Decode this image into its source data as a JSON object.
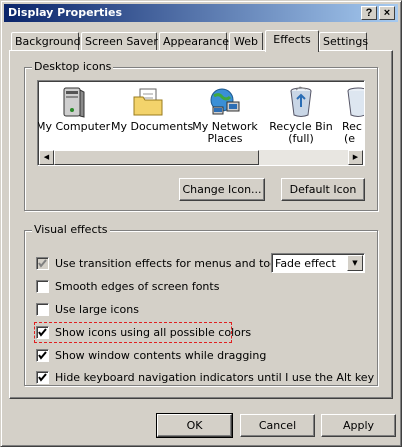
{
  "window": {
    "title": "Display Properties",
    "help_button": "?",
    "close_button": "×"
  },
  "tabs": [
    {
      "label": "Background",
      "active": false
    },
    {
      "label": "Screen Saver",
      "active": false
    },
    {
      "label": "Appearance",
      "active": false
    },
    {
      "label": "Web",
      "active": false
    },
    {
      "label": "Effects",
      "active": true
    },
    {
      "label": "Settings",
      "active": false
    }
  ],
  "desktop_icons": {
    "label": "Desktop icons",
    "items": [
      {
        "label": "My Computer",
        "icon": "my-computer-icon"
      },
      {
        "label": "My Documents",
        "icon": "my-documents-icon"
      },
      {
        "label": "My Network Places",
        "line1": "My Network",
        "line2": "Places",
        "icon": "network-places-icon"
      },
      {
        "label": "Recycle Bin (full)",
        "line1": "Recycle Bin",
        "line2": "(full)",
        "icon": "recycle-bin-icon"
      },
      {
        "label": "Rec (e",
        "line1": "Rec",
        "line2": "(e",
        "icon": "recycle-bin-icon"
      }
    ],
    "change_icon_button": "Change Icon...",
    "default_icon_button": "Default Icon"
  },
  "visual_effects": {
    "label": "Visual effects",
    "options": [
      {
        "label": "Use transition effects for menus and tooltips",
        "checked": true,
        "enabled": false
      },
      {
        "label": "Smooth edges of screen fonts",
        "checked": false,
        "enabled": true
      },
      {
        "label": "Use large icons",
        "checked": false,
        "enabled": true
      },
      {
        "label": "Show icons using all possible colors",
        "checked": true,
        "enabled": true,
        "highlighted": true
      },
      {
        "label": "Show window contents while dragging",
        "checked": true,
        "enabled": true
      },
      {
        "label": "Hide keyboard navigation indicators until I use the Alt key",
        "checked": true,
        "enabled": true
      }
    ],
    "transition_select": {
      "selected": "Fade effect"
    }
  },
  "footer": {
    "ok": "OK",
    "cancel": "Cancel",
    "apply": "Apply"
  },
  "colors": {
    "title_bar_start": "#0a246a",
    "title_bar_end": "#a6caf0",
    "face": "#d4d0c8",
    "highlight_dash": "#e02020"
  }
}
